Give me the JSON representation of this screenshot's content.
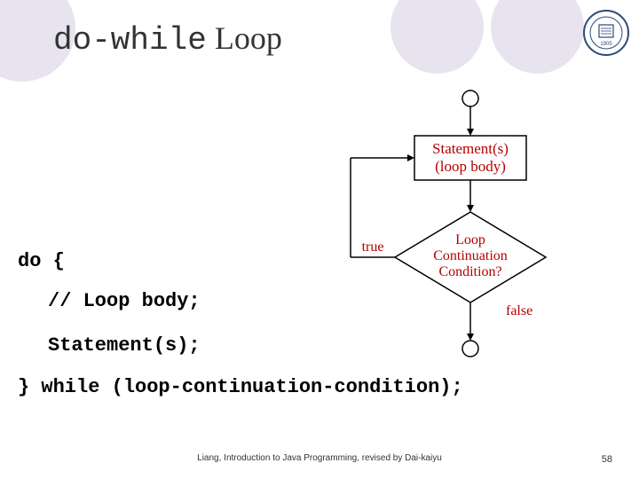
{
  "title": {
    "mono_part": "do-while",
    "rest": " Loop"
  },
  "code": {
    "line1": "do {",
    "line2": "// Loop body;",
    "line3": "Statement(s);",
    "line4": "} while (loop-continuation-condition);"
  },
  "flow": {
    "box_line1": "Statement(s)",
    "box_line2": "(loop body)",
    "diamond_line1": "Loop",
    "diamond_line2": "Continuation",
    "diamond_line3": "Condition?",
    "label_true": "true",
    "label_false": "false"
  },
  "footer": "Liang, Introduction to Java Programming, revised by Dai-kaiyu",
  "page": "58",
  "logo_year": "1905"
}
